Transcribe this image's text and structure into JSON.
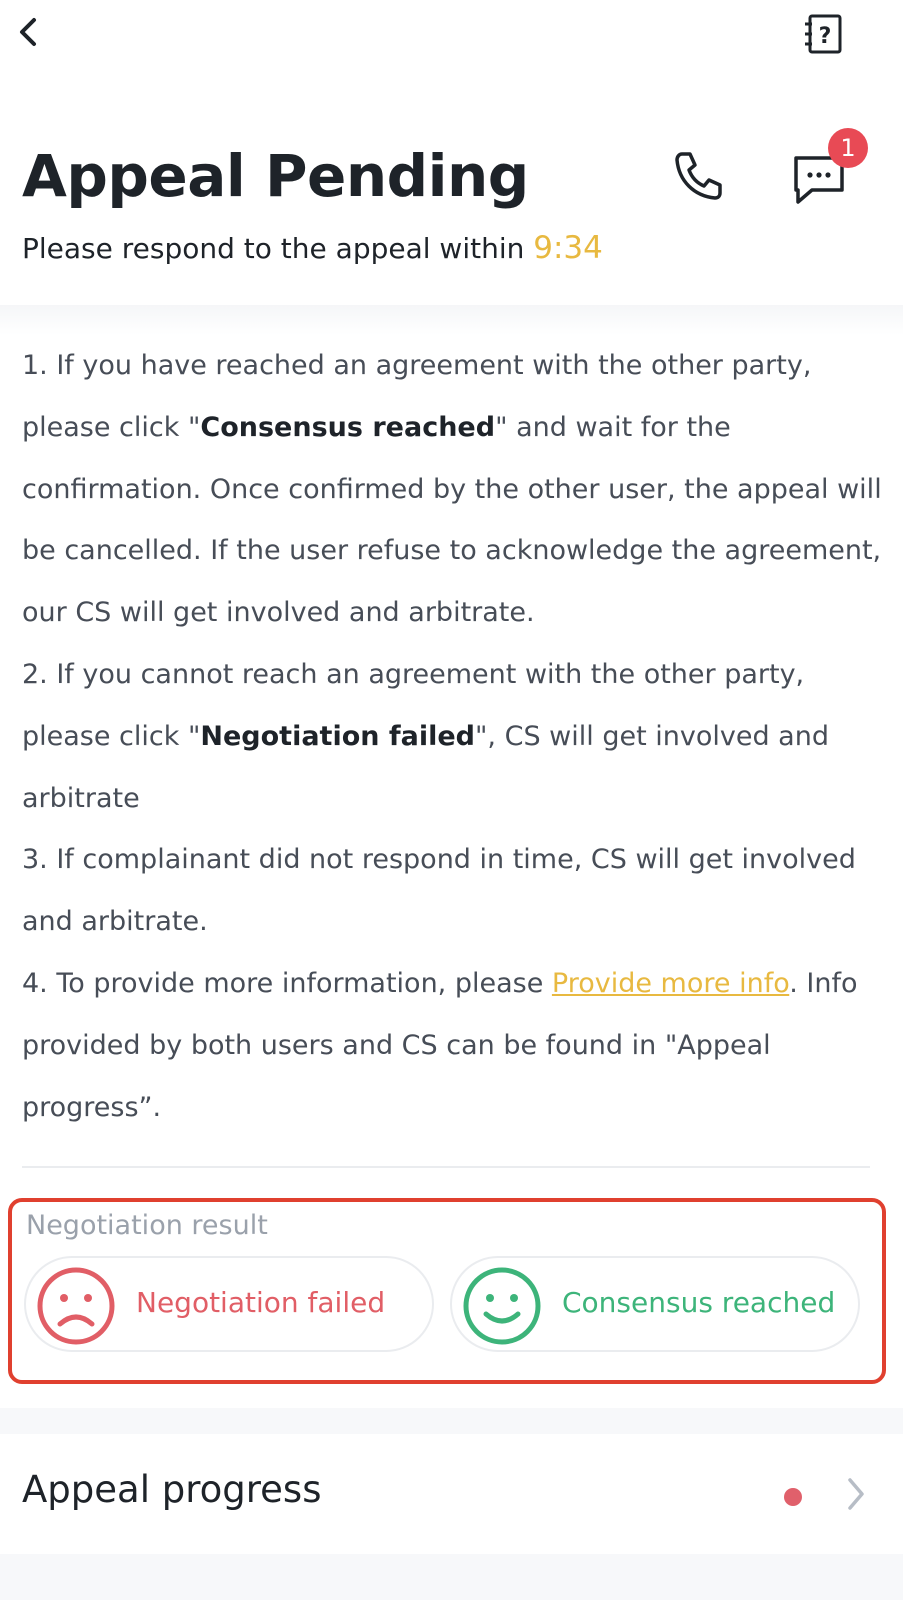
{
  "header": {
    "title": "Appeal Pending",
    "subtitle_prefix": "Please respond to the appeal within ",
    "timer": "9:34",
    "chat_badge": "1"
  },
  "instructions": {
    "p1_a": "1. If you have reached an agreement with the other party, please click \"",
    "p1_bold": "Consensus reached",
    "p1_b": "\" and wait for the confirmation. Once confirmed by the other user, the appeal will be cancelled. If the user refuse to acknowledge the agreement, our CS will get involved and arbitrate.",
    "p2_a": "2. If you cannot reach an agreement with the other party, please click \"",
    "p2_bold": "Negotiation failed",
    "p2_b": "\", CS will get involved and arbitrate",
    "p3": "3. If complainant did not respond in time, CS will get involved and arbitrate.",
    "p4_a": "4. To provide more information, please ",
    "p4_link": "Provide more info",
    "p4_b": ". Info provided by both users and CS can be found in \"Appeal progress”."
  },
  "negotiation": {
    "label": "Negotiation result",
    "failed_label": "Negotiation failed",
    "reached_label": "Consensus reached"
  },
  "progress": {
    "label": "Appeal progress"
  },
  "colors": {
    "accent_yellow": "#e8b940",
    "failed_red": "#e15e66",
    "reached_green": "#3db47a",
    "highlight_box": "#e0402f"
  }
}
